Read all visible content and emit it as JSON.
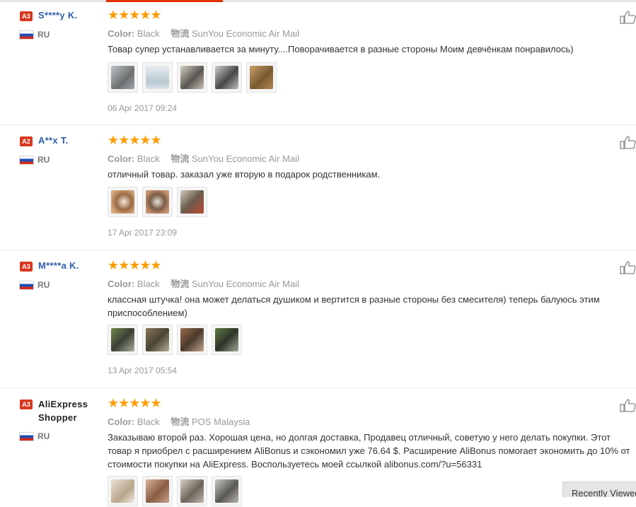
{
  "reviews": [
    {
      "badge": "A3",
      "name": "S****y K.",
      "country": "RU",
      "color_label": "Color:",
      "color_value": "Black",
      "shipping_label": "物流",
      "shipping_value": "SunYou Economic Air Mail",
      "text": "Товар супер устанавливается за минуту....Поворачивается в разные стороны Моим девчёнкам понравилось)",
      "date": "06 Apr 2017 09:24",
      "photos": 5
    },
    {
      "badge": "A2",
      "name": "A**x T.",
      "country": "RU",
      "color_label": "Color:",
      "color_value": "Black",
      "shipping_label": "物流",
      "shipping_value": "SunYou Economic Air Mail",
      "text": "отличный товар. заказал уже вторую в подарок родственникам.",
      "date": "17 Apr 2017 23:09",
      "photos": 3
    },
    {
      "badge": "A3",
      "name": "M****a K.",
      "country": "RU",
      "color_label": "Color:",
      "color_value": "Black",
      "shipping_label": "物流",
      "shipping_value": "SunYou Economic Air Mail",
      "text": "классная штучка! она может делаться душиком и вертится в разные стороны без смесителя) теперь балуюсь этим приспособлением)",
      "date": "13 Apr 2017 05:54",
      "photos": 4
    },
    {
      "badge": "A3",
      "name": "AliExpress Shopper",
      "country": "RU",
      "color_label": "Color:",
      "color_value": "Black",
      "shipping_label": "物流",
      "shipping_value": "POS Malaysia",
      "text": "Заказываю второй раз. Хорошая цена, но долгая доставка, Продавец отличный, советую у него делать покупки. Этот товар я приобрел с расширением AliBonus и сэкономил уже 76.64 $. Расширение AliBonus помогает экономить до 10% от стоимости покупки на AliExpress. Воспользуетесь моей ссылкой alibonus.com/?u=56331",
      "photos": 4
    }
  ],
  "rating_stars": "★★★★★",
  "recently_viewed": "Recently Viewed",
  "colors": {
    "accent": "#e62e04",
    "star": "#ff9c00",
    "username": "#2d5da8",
    "badge": "#d9381e"
  },
  "icons": {
    "like": "thumbs-up-icon",
    "flag": "russia-flag-icon"
  }
}
